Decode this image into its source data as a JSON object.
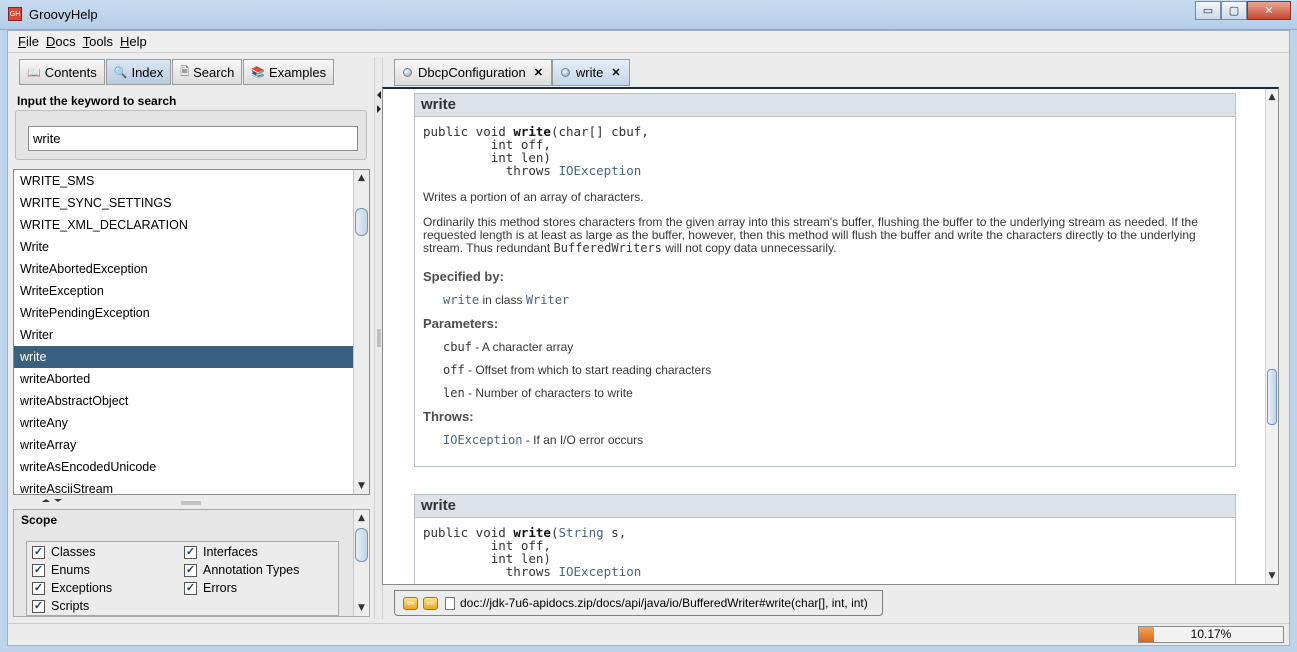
{
  "window": {
    "title": "GroovyHelp",
    "icon_text": "GH",
    "minimize": "▭",
    "maximize": "▢",
    "close": "✕"
  },
  "menubar": [
    {
      "label": "File",
      "mnemonic": "F",
      "rest": "ile"
    },
    {
      "label": "Docs",
      "mnemonic": "D",
      "rest": "ocs"
    },
    {
      "label": "Tools",
      "mnemonic": "T",
      "rest": "ools"
    },
    {
      "label": "Help",
      "mnemonic": "H",
      "rest": "elp"
    }
  ],
  "left_tabs": [
    {
      "label": "Contents",
      "icon": "book-icon",
      "active": false
    },
    {
      "label": "Index",
      "icon": "magnifier-icon",
      "active": true
    },
    {
      "label": "Search",
      "icon": "search-doc-icon",
      "active": false
    },
    {
      "label": "Examples",
      "icon": "examples-icon",
      "active": false
    }
  ],
  "search": {
    "label": "Input the keyword to search",
    "value": "write"
  },
  "index_list": [
    "WRITE_SMS",
    "WRITE_SYNC_SETTINGS",
    "WRITE_XML_DECLARATION",
    "Write",
    "WriteAbortedException",
    "WriteException",
    "WritePendingException",
    "Writer",
    "write",
    "writeAborted",
    "writeAbstractObject",
    "writeAny",
    "writeArray",
    "writeAsEncodedUnicode",
    "writeAsciiStream"
  ],
  "selected_index": 8,
  "scope": {
    "title": "Scope",
    "items": [
      {
        "label": "Classes",
        "checked": true
      },
      {
        "label": "Interfaces",
        "checked": true
      },
      {
        "label": "Enums",
        "checked": true
      },
      {
        "label": "Annotation Types",
        "checked": true
      },
      {
        "label": "Exceptions",
        "checked": true
      },
      {
        "label": "Errors",
        "checked": true
      },
      {
        "label": "Scripts",
        "checked": true
      }
    ]
  },
  "doc_tabs": [
    {
      "label": "DbcpConfiguration",
      "close": "✕",
      "active": false
    },
    {
      "label": "write",
      "close": "✕",
      "active": true
    }
  ],
  "doc": {
    "member1": {
      "name": "write",
      "sig_prefix": "public void ",
      "sig_name": "write",
      "sig_open": "(char[] cbuf,",
      "sig_line2": "         int off,",
      "sig_line3": "         int len)",
      "sig_throws": "           throws ",
      "sig_exception": "IOException",
      "summary": "Writes a portion of an array of characters.",
      "description_a": "Ordinarily this method stores characters from the given array into this stream's buffer, flushing the buffer to the underlying stream as needed. If the requested length is at least as large as the buffer, however, then this method will flush the buffer and write the characters directly to the underlying stream. Thus redundant ",
      "description_code": "BufferedWriters",
      "description_b": " will not copy data unnecessarily.",
      "specified_by_label": "Specified by:",
      "specified_method": "write",
      "specified_in": " in class ",
      "specified_class": "Writer",
      "parameters_label": "Parameters:",
      "params": [
        {
          "name": "cbuf",
          "desc": " - A character array"
        },
        {
          "name": "off",
          "desc": " - Offset from which to start reading characters"
        },
        {
          "name": "len",
          "desc": " - Number of characters to write"
        }
      ],
      "throws_label": "Throws:",
      "throws_name": "IOException",
      "throws_desc": " - If an I/O error occurs"
    },
    "member2": {
      "name": "write",
      "sig_prefix": "public void ",
      "sig_name": "write",
      "sig_open_a": "(",
      "sig_type": "String",
      "sig_open_b": " s,",
      "sig_line2": "         int off,",
      "sig_line3": "         int len)",
      "sig_throws": "           throws ",
      "sig_exception": "IOException"
    }
  },
  "address": {
    "back": "⇦",
    "forward": "⇨",
    "url": "doc://jdk-7u6-apidocs.zip/docs/api/java/io/BufferedWriter#write(char[], int, int)"
  },
  "progress": {
    "value": 0.1017,
    "label": "10.17%"
  },
  "colors": {
    "selection": "#39607f",
    "link": "#4a6782",
    "member_header": "#dee3e9",
    "progress": "#d9661a"
  }
}
